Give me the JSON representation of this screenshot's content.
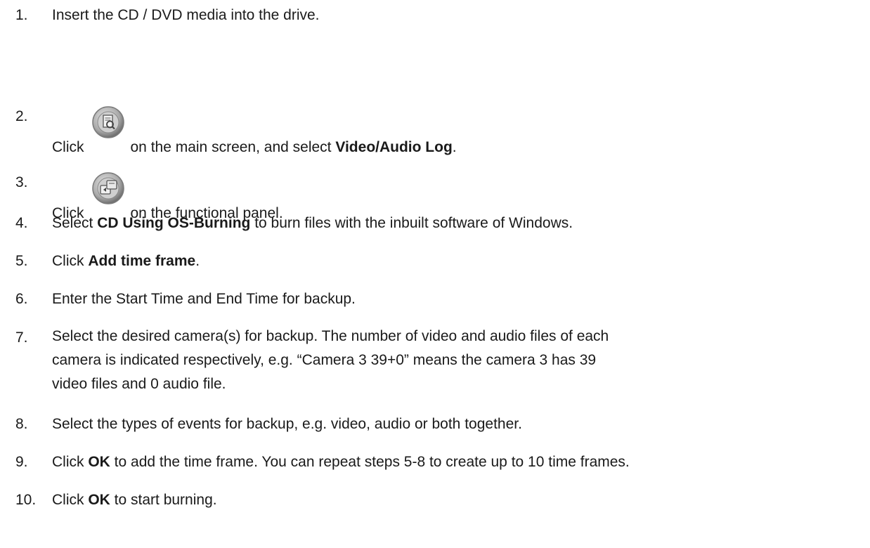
{
  "steps": [
    {
      "number": "1.",
      "parts": [
        "Insert the CD / DVD media into the drive."
      ]
    },
    {
      "number": "2.",
      "pre": "Click",
      "icon": "search-log-icon",
      "post": "on the main screen, and select ",
      "bold": "Video/Audio Log",
      "tail": "."
    },
    {
      "number": "3.",
      "pre": "Click",
      "icon": "backup-icon",
      "post": "on the functional panel."
    },
    {
      "number": "4.",
      "pre": "Select ",
      "bold": "CD Using OS-Burning",
      "post": " to burn files with the inbuilt software of Windows."
    },
    {
      "number": "5.",
      "pre": "Click ",
      "bold": "Add time frame",
      "post": "."
    },
    {
      "number": "6.",
      "text": "Enter the Start Time and End Time for backup."
    },
    {
      "number": "7.",
      "lines": [
        "Select the desired camera(s) for backup. The number of video and audio files of each",
        "camera is indicated respectively, e.g. “Camera 3 39+0” means the camera 3 has 39",
        "video files and 0 audio file."
      ]
    },
    {
      "number": "8.",
      "text": "Select the types of events for backup, e.g. video, audio or both together."
    },
    {
      "number": "9.",
      "pre": "Click ",
      "bold": "OK",
      "post": " to add the time frame. You can repeat steps 5-8 to create up to 10 time frames."
    },
    {
      "number": "10.",
      "pre": "Click ",
      "bold": "OK",
      "post": " to start burning."
    }
  ]
}
